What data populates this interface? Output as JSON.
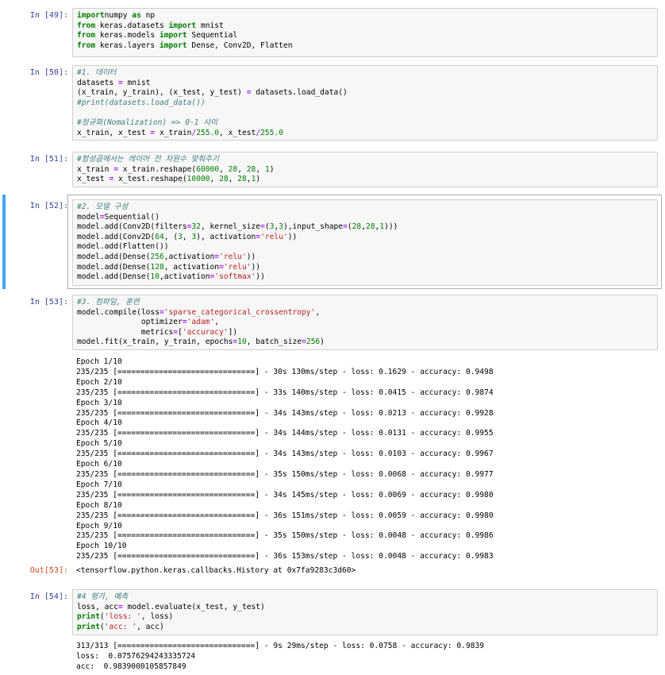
{
  "cells": [
    {
      "prompt": "In [49]:",
      "code": [
        [
          [
            "kw",
            "import"
          ],
          [
            "",
            "numpy "
          ],
          [
            "kw",
            "as"
          ],
          [
            "",
            " np"
          ]
        ],
        [
          [
            "kw",
            "from"
          ],
          [
            "",
            " keras.datasets "
          ],
          [
            "kw",
            "import"
          ],
          [
            "",
            " mnist"
          ]
        ],
        [
          [
            "kw",
            "from"
          ],
          [
            "",
            " keras.models "
          ],
          [
            "kw",
            "import"
          ],
          [
            "",
            " Sequential"
          ]
        ],
        [
          [
            "kw",
            "from"
          ],
          [
            "",
            " keras.layers "
          ],
          [
            "kw",
            "import"
          ],
          [
            "",
            " Dense, Conv2D, Flatten"
          ]
        ]
      ]
    },
    {
      "prompt": "In [50]:",
      "code": [
        [
          [
            "cm",
            "#1. 데이터"
          ]
        ],
        [
          [
            "",
            "datasets "
          ],
          [
            "op",
            "="
          ],
          [
            "",
            " mnist"
          ]
        ],
        [
          [
            "",
            "(x_train, y_train), (x_test, y_test) "
          ],
          [
            "op",
            "="
          ],
          [
            "",
            " datasets.load_data()"
          ]
        ],
        [
          [
            "cm",
            "#print(datasets.load_data())"
          ]
        ],
        [
          [
            "",
            ""
          ]
        ],
        [
          [
            "cm",
            "#정규화(Nomalization) => 0-1 사이"
          ]
        ],
        [
          [
            "",
            "x_train, x_test "
          ],
          [
            "op",
            "="
          ],
          [
            "",
            " x_train"
          ],
          [
            "op",
            "/"
          ],
          [
            "nm",
            "255.0"
          ],
          [
            "",
            ", x_test"
          ],
          [
            "op",
            "/"
          ],
          [
            "nm",
            "255.0"
          ]
        ]
      ]
    },
    {
      "prompt": "In [51]:",
      "code": [
        [
          [
            "cm",
            "#합성곱에서는 레이어 전 차원수 맞춰주기"
          ]
        ],
        [
          [
            "",
            "x_train "
          ],
          [
            "op",
            "="
          ],
          [
            "",
            " x_train.reshape("
          ],
          [
            "nm",
            "60000"
          ],
          [
            "",
            ", "
          ],
          [
            "nm",
            "28"
          ],
          [
            "",
            ", "
          ],
          [
            "nm",
            "28"
          ],
          [
            "",
            ", "
          ],
          [
            "nm",
            "1"
          ],
          [
            "",
            ")"
          ]
        ],
        [
          [
            "",
            "x_test "
          ],
          [
            "op",
            "="
          ],
          [
            "",
            " x_test.reshape("
          ],
          [
            "nm",
            "10000"
          ],
          [
            "",
            ", "
          ],
          [
            "nm",
            "28"
          ],
          [
            "",
            ", "
          ],
          [
            "nm",
            "28"
          ],
          [
            "",
            ","
          ],
          [
            "nm",
            "1"
          ],
          [
            "",
            ")"
          ]
        ]
      ]
    },
    {
      "prompt": "In [52]:",
      "selected": true,
      "code": [
        [
          [
            "cm",
            "#2. 모델 구성"
          ]
        ],
        [
          [
            "",
            "model"
          ],
          [
            "op",
            "="
          ],
          [
            "",
            "Sequential()"
          ]
        ],
        [
          [
            "",
            "model.add(Conv2D(filters"
          ],
          [
            "op",
            "="
          ],
          [
            "nm",
            "32"
          ],
          [
            "",
            ", kernel_size"
          ],
          [
            "op",
            "="
          ],
          [
            "",
            "("
          ],
          [
            "nm",
            "3"
          ],
          [
            "",
            ","
          ],
          [
            "nm",
            "3"
          ],
          [
            "",
            "),input_shape"
          ],
          [
            "op",
            "="
          ],
          [
            "",
            "("
          ],
          [
            "nm",
            "28"
          ],
          [
            "",
            ","
          ],
          [
            "nm",
            "28"
          ],
          [
            "",
            ","
          ],
          [
            "nm",
            "1"
          ],
          [
            "",
            ")))"
          ]
        ],
        [
          [
            "",
            "model.add(Conv2D("
          ],
          [
            "nm",
            "64"
          ],
          [
            "",
            ", ("
          ],
          [
            "nm",
            "3"
          ],
          [
            "",
            ", "
          ],
          [
            "nm",
            "3"
          ],
          [
            "",
            "), activation"
          ],
          [
            "op",
            "="
          ],
          [
            "st",
            "'relu'"
          ],
          [
            "",
            "))"
          ]
        ],
        [
          [
            "",
            "model.add(Flatten())"
          ]
        ],
        [
          [
            "",
            "model.add(Dense("
          ],
          [
            "nm",
            "256"
          ],
          [
            "",
            ",activation"
          ],
          [
            "op",
            "="
          ],
          [
            "st",
            "'relu'"
          ],
          [
            "",
            "))"
          ]
        ],
        [
          [
            "",
            "model.add(Dense("
          ],
          [
            "nm",
            "128"
          ],
          [
            "",
            ", activation"
          ],
          [
            "op",
            "="
          ],
          [
            "st",
            "'relu'"
          ],
          [
            "",
            "))"
          ]
        ],
        [
          [
            "",
            "model.add(Dense("
          ],
          [
            "nm",
            "10"
          ],
          [
            "",
            ",activation"
          ],
          [
            "op",
            "="
          ],
          [
            "st",
            "'softmax'"
          ],
          [
            "",
            "))"
          ]
        ]
      ]
    },
    {
      "prompt": "In [53]:",
      "code": [
        [
          [
            "cm",
            "#3. 컴파일, 훈련"
          ]
        ],
        [
          [
            "",
            "model.compile(loss"
          ],
          [
            "op",
            "="
          ],
          [
            "st",
            "'sparse_categorical_crossentropy'"
          ],
          [
            "",
            ","
          ]
        ],
        [
          [
            "",
            "              optimizer"
          ],
          [
            "op",
            "="
          ],
          [
            "st",
            "'adam'"
          ],
          [
            "",
            ","
          ]
        ],
        [
          [
            "",
            "              metrics"
          ],
          [
            "op",
            "="
          ],
          [
            "",
            "["
          ],
          [
            "st",
            "'accuracy'"
          ],
          [
            "",
            "])"
          ]
        ],
        [
          [
            "",
            "model.fit(x_train, y_train, epochs"
          ],
          [
            "op",
            "="
          ],
          [
            "nm",
            "10"
          ],
          [
            "",
            ", batch_size"
          ],
          [
            "op",
            "="
          ],
          [
            "nm",
            "256"
          ],
          [
            "",
            ")"
          ]
        ]
      ],
      "output": [
        "Epoch 1/10",
        "235/235 [==============================] - 30s 130ms/step - loss: 0.1629 - accuracy: 0.9498",
        "Epoch 2/10",
        "235/235 [==============================] - 33s 140ms/step - loss: 0.0415 - accuracy: 0.9874",
        "Epoch 3/10",
        "235/235 [==============================] - 34s 143ms/step - loss: 0.0213 - accuracy: 0.9928",
        "Epoch 4/10",
        "235/235 [==============================] - 34s 144ms/step - loss: 0.0131 - accuracy: 0.9955",
        "Epoch 5/10",
        "235/235 [==============================] - 34s 143ms/step - loss: 0.0103 - accuracy: 0.9967",
        "Epoch 6/10",
        "235/235 [==============================] - 35s 150ms/step - loss: 0.0068 - accuracy: 0.9977",
        "Epoch 7/10",
        "235/235 [==============================] - 34s 145ms/step - loss: 0.0069 - accuracy: 0.9980",
        "Epoch 8/10",
        "235/235 [==============================] - 36s 151ms/step - loss: 0.0059 - accuracy: 0.9980",
        "Epoch 9/10",
        "235/235 [==============================] - 35s 150ms/step - loss: 0.0048 - accuracy: 0.9986",
        "Epoch 10/10",
        "235/235 [==============================] - 36s 153ms/step - loss: 0.0048 - accuracy: 0.9983"
      ],
      "out_prompt": "Out[53]:",
      "out_result": "<tensorflow.python.keras.callbacks.History at 0x7fa9283c3d60>"
    },
    {
      "prompt": "In [54]:",
      "code": [
        [
          [
            "cm",
            "#4 평가, 예측"
          ]
        ],
        [
          [
            "",
            "loss, acc"
          ],
          [
            "op",
            "="
          ],
          [
            "",
            " model.evaluate(x_test, y_test)"
          ]
        ],
        [
          [
            "kw",
            "print"
          ],
          [
            "",
            "("
          ],
          [
            "st",
            "'loss: '"
          ],
          [
            "",
            ", loss)"
          ]
        ],
        [
          [
            "kw",
            "print"
          ],
          [
            "",
            "("
          ],
          [
            "st",
            "'acc: '"
          ],
          [
            "",
            ", acc)"
          ]
        ]
      ],
      "output": [
        "313/313 [==============================] - 9s 29ms/step - loss: 0.0758 - accuracy: 0.9839",
        "loss:  0.07576294243335724",
        "acc:  0.9839000105857849"
      ]
    }
  ]
}
